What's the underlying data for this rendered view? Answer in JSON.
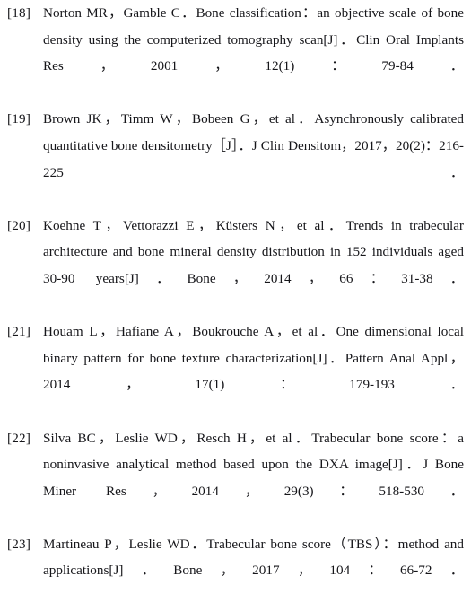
{
  "document": {
    "type": "bibliography",
    "page_background": "#ffffff",
    "text_color": "#16161a",
    "references": [
      {
        "label": "[18]",
        "text": "Norton MR，Gamble C．Bone classification：an objective scale of bone density using the computerized tomography scan[J]．Clin Oral Implants Res，2001，12(1)：79-84．"
      },
      {
        "label": "[19]",
        "text": "Brown JK，Timm W，Bobeen G，et al．Asynchronously calibrated quantitative bone densitometry［J］．J Clin Densitom，2017，20(2)：216-225．"
      },
      {
        "label": "[20]",
        "text": "Koehne T，Vettorazzi E，Küsters N，et al．Trends in trabecular architecture and bone mineral density distribution in 152 individuals aged 30-90 years[J]．Bone，2014，66：31-38．"
      },
      {
        "label": "[21]",
        "text": "Houam L，Hafiane A，Boukrouche A，et al．One dimensional local binary pattern for bone texture characterization[J]．Pattern Anal Appl，2014，17(1)：179-193．"
      },
      {
        "label": "[22]",
        "text": "Silva BC，Leslie WD，Resch H，et al．Trabecular bone score：a noninvasive analytical method based upon the DXA image[J]．J Bone Miner Res，2014，29(3)：518-530．"
      },
      {
        "label": "[23]",
        "text": "Martineau P，Leslie WD．Trabecular bone score（TBS）：method and applications[J]．Bone，2017，104：66-72．"
      }
    ]
  }
}
